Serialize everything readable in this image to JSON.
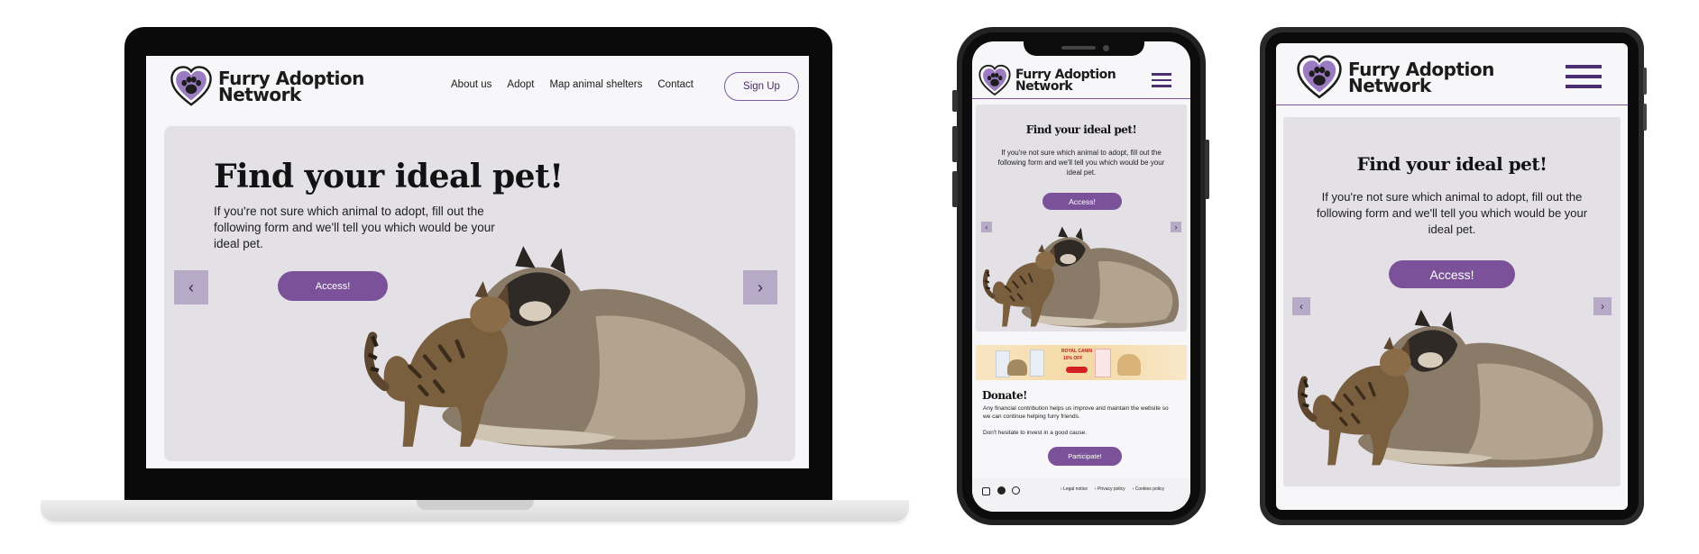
{
  "brand": {
    "line1": "Furry Adoption",
    "line2": "Network",
    "accent": "#7b5299",
    "accent_dark": "#4b2d72",
    "hero_bg": "#e4e1e6"
  },
  "nav": {
    "items": [
      "About us",
      "Adopt",
      "Map animal shelters",
      "Contact"
    ],
    "signup": "Sign Up"
  },
  "hero": {
    "title": "Find your ideal pet!",
    "text": "If you're not sure which animal to adopt, fill out the following form and we'll tell you which would be your ideal pet.",
    "cta": "Access!",
    "prev_icon": "chevron-left-icon",
    "next_icon": "chevron-right-icon"
  },
  "banner": {
    "brand_text": "ROYAL CANIN",
    "offer_text": "10% OFF"
  },
  "donate": {
    "title": "Donate!",
    "text1": "Any financial contribution helps us improve and maintain the website so we can continue helping furry friends.",
    "text2": "Don't hesitate to invest in a good cause.",
    "cta": "Participate!"
  },
  "footer": {
    "social_icons": [
      "instagram-icon",
      "facebook-icon",
      "whatsapp-icon"
    ],
    "links": [
      "Legal notice",
      "Privacy policy",
      "Cookies policy"
    ]
  }
}
